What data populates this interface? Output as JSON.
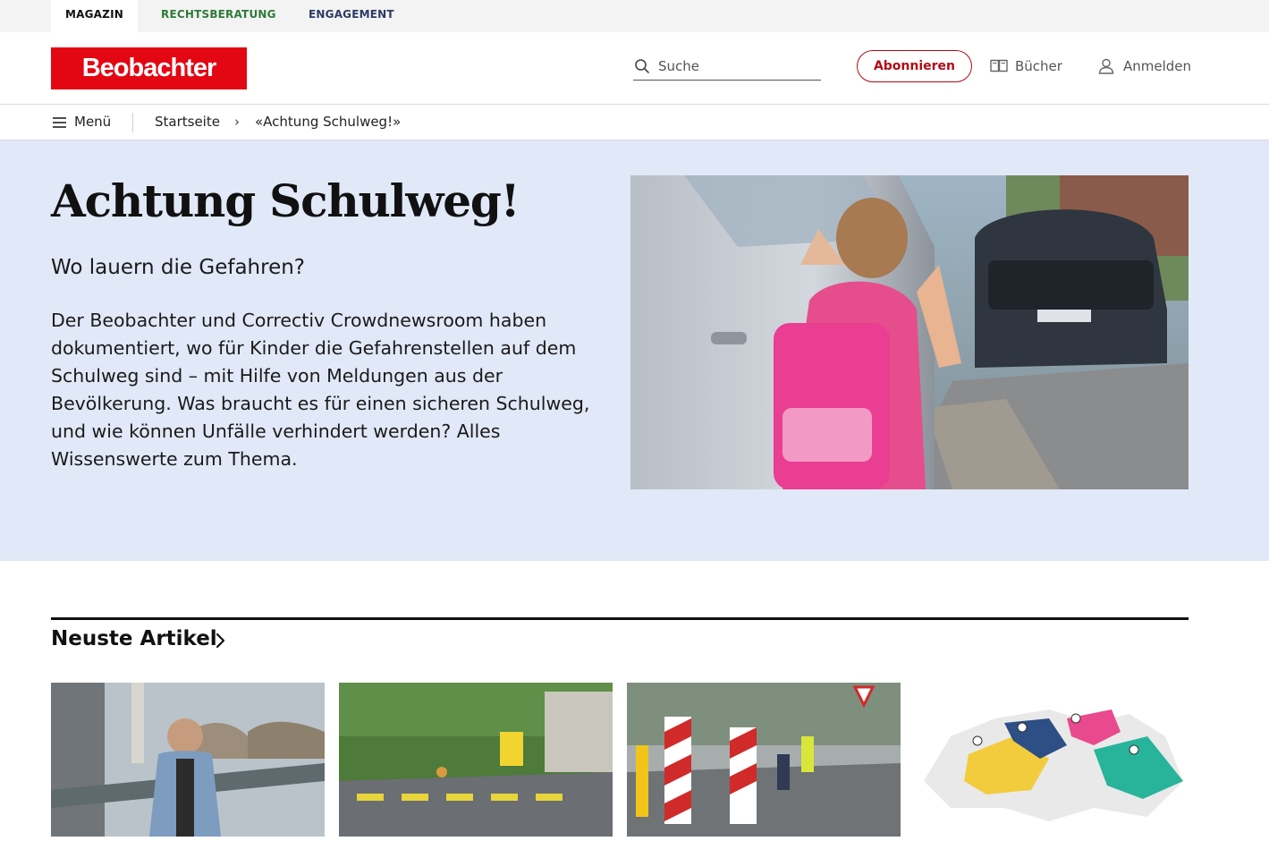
{
  "topnav": {
    "tabs": [
      {
        "label": "MAGAZIN"
      },
      {
        "label": "RECHTSBERATUNG"
      },
      {
        "label": "ENGAGEMENT"
      }
    ]
  },
  "header": {
    "logo_text": "Beobachter",
    "search_placeholder": "Suche",
    "subscribe_label": "Abonnieren",
    "books_label": "Bücher",
    "login_label": "Anmelden",
    "brand_color": "#e30613"
  },
  "breadcrumb": {
    "menu_label": "Menü",
    "items": [
      "Startseite",
      "«Achtung Schulweg!»"
    ],
    "separator": "›"
  },
  "hero": {
    "title": "Achtung Schulweg!",
    "subtitle": "Wo lauern die Gefahren?",
    "lead": "Der Beobachter und Correctiv Crowdnewsroom haben dokumentiert, wo für Kinder die Gefahrenstellen auf dem Schulweg sind – mit Hilfe von Meldungen aus der Bevölkerung. Was braucht es für einen sicheren Schulweg, und wie können Unfälle verhindert werden? Alles Wissenswerte zum Thema.",
    "image": "photo of girl with pink school backpack beside parked cars",
    "background_color": "#e1e8f7"
  },
  "section": {
    "title": "Neuste Artikel",
    "cards": [
      {
        "image": "smiling man in denim jacket on bridge"
      },
      {
        "image": "tree-lined street with pedestrian crossing"
      },
      {
        "image": "children crossing rainy road with barriers"
      },
      {
        "image": "illustrated map of Switzerland"
      }
    ]
  }
}
